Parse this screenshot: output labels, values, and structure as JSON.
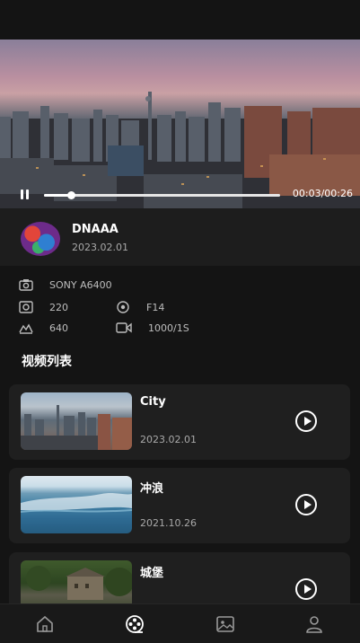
{
  "player": {
    "time_label": "00:03/00:26",
    "progress": 0.115
  },
  "author": {
    "name": "DNAAA",
    "date": "2023.02.01"
  },
  "specs": {
    "camera": "SONY A6400",
    "iso": "220",
    "aperture": "F14",
    "resolution": "640",
    "shutter": "1000/1S"
  },
  "section_title": "视频列表",
  "videos": [
    {
      "title": "City",
      "date": "2023.02.01"
    },
    {
      "title": "冲浪",
      "date": "2021.10.26"
    },
    {
      "title": "城堡",
      "date": ""
    }
  ],
  "tabs": [
    {
      "icon": "home-icon"
    },
    {
      "icon": "video-reel-icon",
      "active": true
    },
    {
      "icon": "image-icon"
    },
    {
      "icon": "profile-icon"
    }
  ]
}
